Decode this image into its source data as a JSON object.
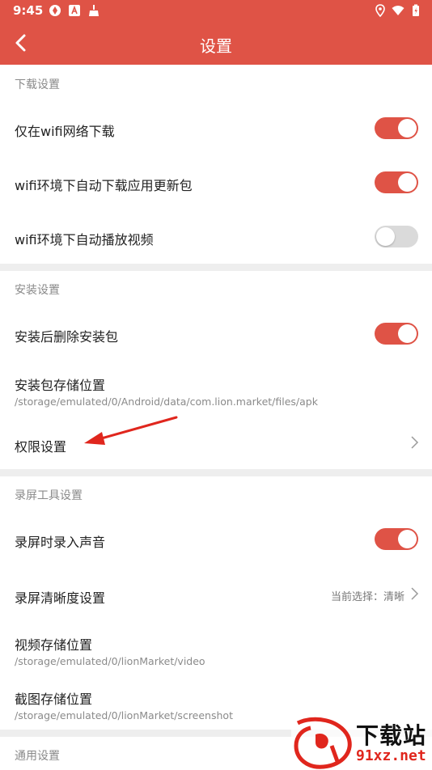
{
  "status_bar": {
    "time": "9:45"
  },
  "header": {
    "title": "设置"
  },
  "sections": {
    "download": {
      "header": "下载设置",
      "wifi_only": {
        "label": "仅在wifi网络下载",
        "enabled": true
      },
      "auto_update": {
        "label": "wifi环境下自动下载应用更新包",
        "enabled": true
      },
      "autoplay": {
        "label": "wifi环境下自动播放视频",
        "enabled": false
      }
    },
    "install": {
      "header": "安装设置",
      "delete_after": {
        "label": "安装后删除安装包",
        "enabled": true
      },
      "storage": {
        "label": "安装包存储位置",
        "path": "/storage/emulated/0/Android/data/com.lion.market/files/apk"
      },
      "permissions": {
        "label": "权限设置"
      }
    },
    "recorder": {
      "header": "录屏工具设置",
      "record_audio": {
        "label": "录屏时录入声音",
        "enabled": true
      },
      "quality": {
        "label": "录屏清晰度设置",
        "value": "当前选择：清晰"
      },
      "video_storage": {
        "label": "视频存储位置",
        "path": "/storage/emulated/0/lionMarket/video"
      },
      "screenshot_storage": {
        "label": "截图存储位置",
        "path": "/storage/emulated/0/lionMarket/screenshot"
      }
    },
    "general": {
      "header": "通用设置"
    }
  },
  "watermark": {
    "top": "下载站",
    "bottom": "91xz.net"
  },
  "colors": {
    "accent": "#df5346",
    "divider": "#eeeeee",
    "toggle_off": "#dadada"
  }
}
